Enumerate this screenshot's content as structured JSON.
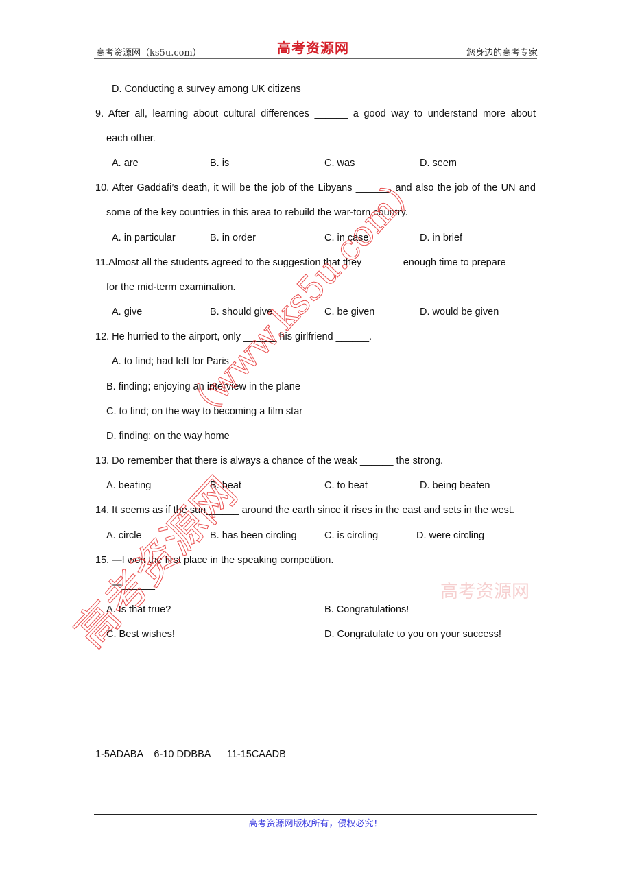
{
  "header": {
    "left": "高考资源网（ks5u.com）",
    "logo": "高考资源网",
    "right": "您身边的高考专家"
  },
  "prev_option": "D. Conducting a survey among UK citizens",
  "questions": [
    {
      "number": "9",
      "lines": [
        "9. After all, learning about cultural differences ______ a good way to understand more about",
        "each other."
      ],
      "options": [
        "A. are",
        "B. is",
        "C. was",
        "D. seem"
      ]
    },
    {
      "number": "10",
      "lines": [
        "10. After Gaddafi’s death, it will be the job of the Libyans ______, and also the job of the UN and",
        "some of the key countries in this area to rebuild the war-torn country."
      ],
      "options": [
        "A. in particular",
        "B. in order",
        "C. in case",
        "D. in brief"
      ]
    },
    {
      "number": "11",
      "lines": [
        "11.Almost all the students agreed to the suggestion that they _______enough time to prepare",
        "for the mid-term examination."
      ],
      "options": [
        "A. give",
        "B. should give",
        "C. be given",
        "D. would be given"
      ]
    },
    {
      "number": "12",
      "lines": [
        "12. He hurried to the airport, only ______ his girlfriend ______."
      ],
      "options": [
        "A. to find; had left for Paris",
        "B. finding; enjoying an interview in the plane",
        "C. to find; on the way to becoming a film star",
        "D. finding; on the way home"
      ]
    },
    {
      "number": "13",
      "lines": [
        "13. Do remember that there is always a chance of the weak ______ the strong."
      ],
      "options": [
        "A. beating",
        "B. beat",
        "C. to beat",
        "D. being beaten"
      ]
    },
    {
      "number": "14",
      "lines": [
        "14. It seems as if the sun______ around the earth since it rises in the east and sets in the west."
      ],
      "options": [
        "A. circle",
        "B. has been circling",
        "C. is circling",
        "D. were circling"
      ]
    },
    {
      "number": "15",
      "lines": [
        "15. —I won the first place in the speaking competition.",
        "—______"
      ],
      "options": [
        "A. Is that true?",
        "B. Congratulations!",
        "C. Best wishes!",
        "D. Congratulate to you on your success!"
      ]
    }
  ],
  "answers": "1-5ADABA    6-10 DDBBA      11-15CAADB",
  "watermark": {
    "url": "（www.ks5u.com）",
    "cn": "高考资源网",
    "faint": "高考资源网"
  },
  "footer": "高考资源网版权所有，侵权必究！"
}
